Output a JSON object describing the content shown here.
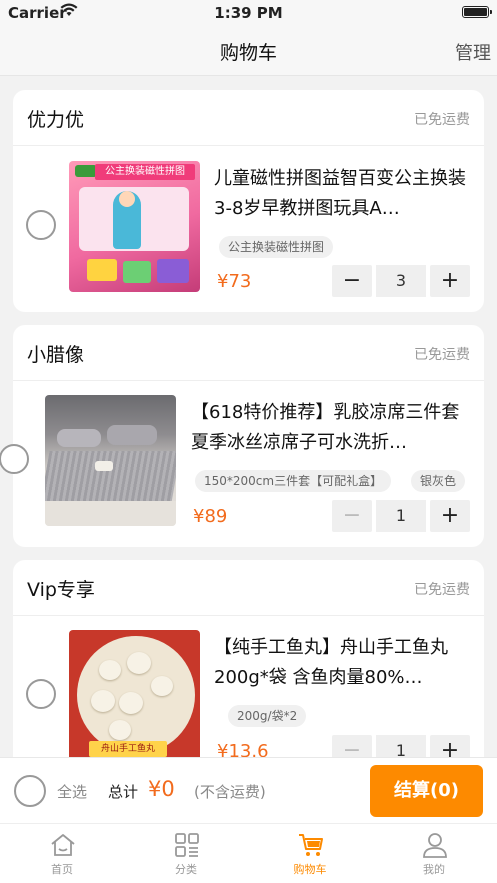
{
  "status": {
    "carrier": "Carrier",
    "time": "1:39 PM"
  },
  "nav": {
    "title": "购物车",
    "manage": "管理"
  },
  "shops": [
    {
      "name": "优力优",
      "shipping": "已免运费",
      "item": {
        "title": "儿童磁性拼图益智百变公主换装3-8岁早教拼图玩具A…",
        "spec": "公主换装磁性拼图",
        "price": "¥73",
        "quantity": "3",
        "thumb_label": "公主换装磁性拼图"
      }
    },
    {
      "name": "小腊像",
      "shipping": "已免运费",
      "item": {
        "title": "【618特价推荐】乳胶凉席三件套夏季冰丝凉席子可水洗折…",
        "spec": "150*200cm三件套【可配礼盒】",
        "spec2": "银灰色",
        "price": "¥89",
        "quantity": "1"
      }
    },
    {
      "name": "Vip专享",
      "shipping": "已免运费",
      "item": {
        "title": "【纯手工鱼丸】舟山手工鱼丸200g*袋 含鱼肉量80%…",
        "spec": "200g/袋*2",
        "price": "¥13.6",
        "quantity": "1",
        "thumb_label": "舟山手工鱼丸"
      }
    }
  ],
  "stepper": {
    "minus": "−",
    "plus": "+"
  },
  "bottom": {
    "select_all": "全选",
    "total_label": "总计",
    "total_value": "¥0",
    "shipping_note": "(不含运费)",
    "checkout": "结算(0)"
  },
  "tabs": [
    {
      "label": "首页",
      "icon": "home-icon"
    },
    {
      "label": "分类",
      "icon": "category-icon"
    },
    {
      "label": "购物车",
      "icon": "cart-icon"
    },
    {
      "label": "我的",
      "icon": "user-icon"
    }
  ],
  "colors": {
    "accent": "#fd8a00",
    "price": "#f26b1d",
    "background": "#f2f2f2"
  }
}
